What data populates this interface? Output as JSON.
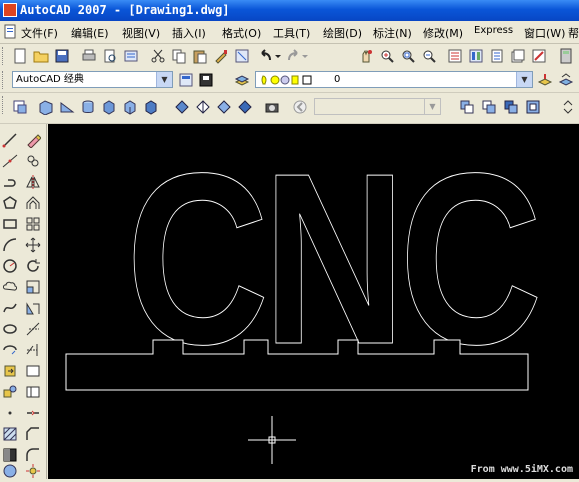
{
  "window": {
    "title": "AutoCAD 2007 - [Drawing1.dwg]"
  },
  "menu": [
    {
      "label": "文件(F)"
    },
    {
      "label": "编辑(E)"
    },
    {
      "label": "视图(V)"
    },
    {
      "label": "插入(I)"
    },
    {
      "label": "格式(O)"
    },
    {
      "label": "工具(T)"
    },
    {
      "label": "绘图(D)"
    },
    {
      "label": "标注(N)"
    },
    {
      "label": "修改(M)"
    },
    {
      "label": "Express"
    },
    {
      "label": "窗口(W)"
    },
    {
      "label": "帮"
    }
  ],
  "workspace": {
    "value": "AutoCAD 经典"
  },
  "layer": {
    "value": "0"
  },
  "drawing": {
    "text": "CNC"
  },
  "watermark": {
    "text": "From www.5iMX.com"
  },
  "colors": {
    "canvas": "#000000",
    "linework": "#ffffff",
    "titlebar": "#0a56d8"
  }
}
